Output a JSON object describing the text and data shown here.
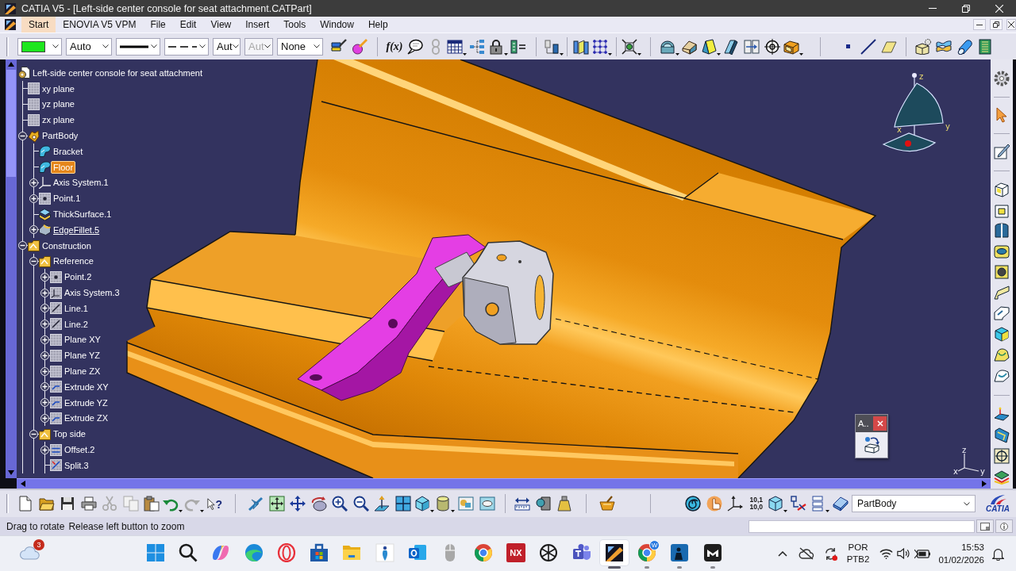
{
  "window": {
    "title": "CATIA V5 - [Left-side center console for seat attachment.CATPart]"
  },
  "menu": [
    {
      "label": "Start",
      "selected": true
    },
    {
      "label": "ENOVIA V5 VPM",
      "selected": false
    },
    {
      "label": "File",
      "selected": false
    },
    {
      "label": "Edit",
      "selected": false
    },
    {
      "label": "View",
      "selected": false
    },
    {
      "label": "Insert",
      "selected": false
    },
    {
      "label": "Tools",
      "selected": false
    },
    {
      "label": "Window",
      "selected": false
    },
    {
      "label": "Help",
      "selected": false
    }
  ],
  "graphic_properties": [
    {
      "kind": "swatch",
      "color": "#1ee61e",
      "disabled": false
    },
    {
      "kind": "text",
      "value": "Auto",
      "disabled": false
    },
    {
      "kind": "line_weight",
      "disabled": false
    },
    {
      "kind": "line_type",
      "disabled": false
    },
    {
      "kind": "text",
      "value": "Aut",
      "disabled": false
    },
    {
      "kind": "text",
      "value": "Aut",
      "disabled": true
    },
    {
      "kind": "text",
      "value": "None",
      "disabled": false
    }
  ],
  "top_toolbar": {
    "formula_label": "f(x)"
  },
  "tree": {
    "label": "Left-side center console for seat attachment",
    "kind": "part",
    "selected": false,
    "in_work": false,
    "children": [
      {
        "label": "xy plane",
        "kind": "plane",
        "selected": false,
        "in_work": false
      },
      {
        "label": "yz plane",
        "kind": "plane",
        "selected": false,
        "in_work": false
      },
      {
        "label": "zx plane",
        "kind": "plane",
        "selected": false,
        "in_work": false
      },
      {
        "label": "PartBody",
        "kind": "body",
        "expanded": true,
        "selected": false,
        "in_work": false,
        "children": [
          {
            "label": "Bracket",
            "kind": "solid",
            "selected": false,
            "in_work": false
          },
          {
            "label": "Floor",
            "kind": "solid",
            "selected": true,
            "in_work": false
          },
          {
            "label": "Axis System.1",
            "kind": "axis",
            "expanded": false,
            "selected": false,
            "in_work": false
          },
          {
            "label": "Point.1",
            "kind": "point",
            "expanded": false,
            "selected": false,
            "in_work": false
          },
          {
            "label": "ThickSurface.1",
            "kind": "thick_surface",
            "selected": false,
            "in_work": false
          },
          {
            "label": "EdgeFillet.5",
            "kind": "fillet",
            "expanded": false,
            "selected": false,
            "in_work": true
          }
        ]
      },
      {
        "label": "Construction",
        "kind": "geometrical_set",
        "expanded": true,
        "selected": false,
        "in_work": false,
        "children": [
          {
            "label": "Reference",
            "kind": "geometrical_set",
            "expanded": true,
            "selected": false,
            "in_work": false,
            "children": [
              {
                "label": "Point.2",
                "kind": "point",
                "expanded": false,
                "selected": false,
                "in_work": false
              },
              {
                "label": "Axis System.3",
                "kind": "axis_grid",
                "expanded": false,
                "selected": false,
                "in_work": false
              },
              {
                "label": "Line.1",
                "kind": "line",
                "expanded": false,
                "selected": false,
                "in_work": false
              },
              {
                "label": "Line.2",
                "kind": "line",
                "expanded": false,
                "selected": false,
                "in_work": false
              },
              {
                "label": "Plane XY",
                "kind": "plane",
                "expanded": false,
                "selected": false,
                "in_work": false
              },
              {
                "label": "Plane YZ",
                "kind": "plane",
                "expanded": false,
                "selected": false,
                "in_work": false
              },
              {
                "label": "Plane ZX",
                "kind": "plane",
                "expanded": false,
                "selected": false,
                "in_work": false
              },
              {
                "label": "Extrude XY",
                "kind": "extrude",
                "expanded": false,
                "selected": false,
                "in_work": false
              },
              {
                "label": "Extrude YZ",
                "kind": "extrude",
                "expanded": false,
                "selected": false,
                "in_work": false
              },
              {
                "label": "Extrude ZX",
                "kind": "extrude",
                "expanded": false,
                "selected": false,
                "in_work": false
              }
            ]
          },
          {
            "label": "Top side",
            "kind": "geometrical_set",
            "expanded": true,
            "selected": false,
            "in_work": false,
            "children": [
              {
                "label": "Offset.2",
                "kind": "offset",
                "expanded": false,
                "selected": false,
                "in_work": false
              },
              {
                "label": "Split.3",
                "kind": "split",
                "selected": false,
                "in_work": false
              }
            ]
          }
        ]
      }
    ]
  },
  "compass": {
    "axes": [
      "z",
      "x",
      "y"
    ]
  },
  "mini_toolbar": {
    "title": "A.."
  },
  "axis_triad": {
    "axes": [
      "z",
      "x",
      "y"
    ]
  },
  "bottom_toolbar": {
    "help_mark": "?",
    "decimal_display": [
      "10,1",
      "10,0"
    ],
    "work_object": "PartBody",
    "logo_text": "CATIA"
  },
  "status_bar": {
    "messages": [
      "Drag to rotate",
      "Release left button to zoom"
    ]
  },
  "taskbar": {
    "weather_badge": "3",
    "apps": [
      {
        "kind": "start",
        "running": false,
        "active": false
      },
      {
        "kind": "search",
        "running": false,
        "active": false
      },
      {
        "kind": "swirl",
        "running": false,
        "active": false
      },
      {
        "kind": "browser_wave",
        "running": false,
        "active": false
      },
      {
        "kind": "ring",
        "running": false,
        "active": false
      },
      {
        "kind": "bag",
        "running": false,
        "active": false
      },
      {
        "kind": "folder",
        "running": false,
        "active": false
      },
      {
        "kind": "figure",
        "running": false,
        "active": false
      },
      {
        "kind": "mail",
        "running": false,
        "active": false
      },
      {
        "kind": "mouse",
        "running": false,
        "active": false
      },
      {
        "kind": "browser_wheel",
        "running": false,
        "active": false
      },
      {
        "kind": "letters",
        "label": "NX",
        "running": false,
        "active": false
      },
      {
        "kind": "knot",
        "running": false,
        "active": false
      },
      {
        "kind": "team",
        "running": false,
        "active": false
      },
      {
        "kind": "cad",
        "running": true,
        "active": true
      },
      {
        "kind": "browser_wheel",
        "badge": "W",
        "running": true,
        "active": false
      },
      {
        "kind": "reader",
        "running": true,
        "active": false
      },
      {
        "kind": "mask",
        "running": true,
        "active": false
      }
    ],
    "language": [
      "POR",
      "PTB2"
    ],
    "time": "15:53",
    "date": "01/02/2026"
  }
}
